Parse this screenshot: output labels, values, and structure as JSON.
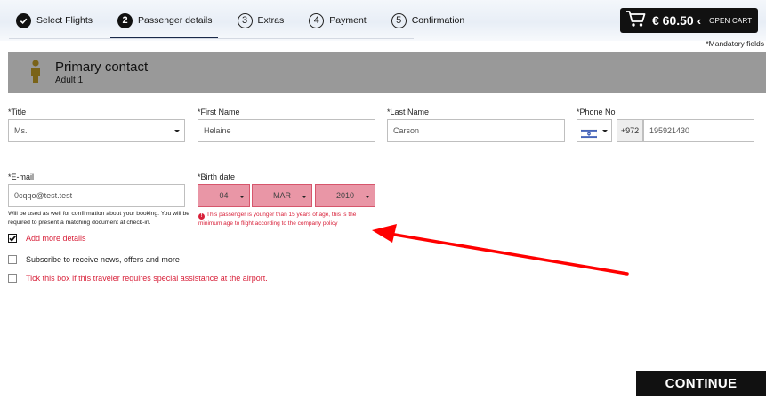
{
  "steps": [
    {
      "num": "",
      "label": "Select Flights",
      "state": "done"
    },
    {
      "num": "2",
      "label": "Passenger details",
      "state": "active"
    },
    {
      "num": "3",
      "label": "Extras",
      "state": "todo"
    },
    {
      "num": "4",
      "label": "Payment",
      "state": "todo"
    },
    {
      "num": "5",
      "label": "Confirmation",
      "state": "todo"
    }
  ],
  "cart": {
    "price": "€ 60.50",
    "chevron": "‹",
    "label": "OPEN CART"
  },
  "mandatory_note": "*Mandatory fields",
  "contact": {
    "title": "Primary contact",
    "subtitle": "Adult 1"
  },
  "fields": {
    "title": {
      "label": "*Title",
      "value": "Ms."
    },
    "first_name": {
      "label": "*First Name",
      "value": "Helaine"
    },
    "last_name": {
      "label": "*Last Name",
      "value": "Carson"
    },
    "phone": {
      "label": "*Phone No",
      "code": "+972",
      "value": "195921430"
    },
    "email": {
      "label": "*E-mail",
      "value": "0cqqo@test.test",
      "note": "Will be used as well for confirmation about your booking. You will be required to present a matching document at check-in."
    },
    "birth_date": {
      "label": "*Birth date",
      "day": "04",
      "month": "MAR",
      "year": "2010",
      "error": "This passenger is younger than 15 years of age, this is the minimum age to flight according to the company policy"
    }
  },
  "checkboxes": {
    "add_details": {
      "label": "Add more details",
      "checked": true
    },
    "subscribe": {
      "label": "Subscribe to receive news, offers and more",
      "checked": false
    },
    "assistance": {
      "label": "Tick this box if this traveler requires special assistance at the airport.",
      "checked": false
    }
  },
  "continue_label": "CONTINUE",
  "colors": {
    "error": "#d8213a",
    "error_fill": "#e996a6",
    "header_bar": "#999999",
    "dark": "#111111",
    "annotation_arrow": "#ff0000"
  }
}
